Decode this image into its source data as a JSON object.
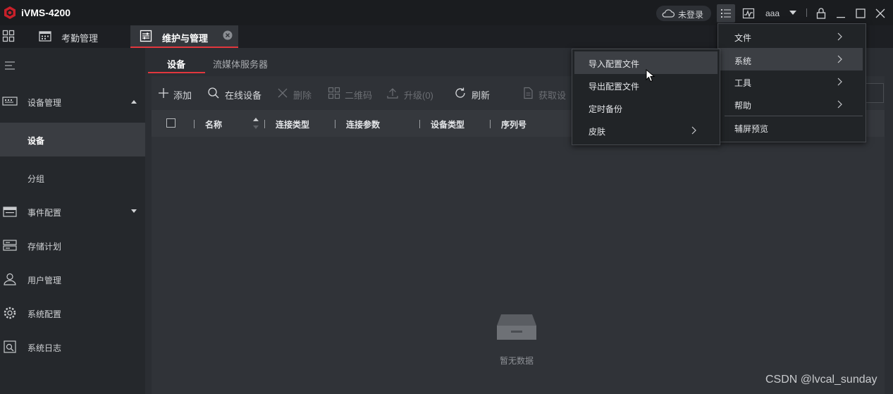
{
  "app": {
    "title": "iVMS-4200"
  },
  "titlebar": {
    "login_status": "未登录",
    "user": "aaa"
  },
  "tabs": [
    {
      "label": "考勤管理"
    },
    {
      "label": "维护与管理",
      "active": true
    }
  ],
  "sidebar": {
    "items": [
      {
        "label": "设备管理",
        "icon": "device-manage-icon",
        "expanded": true
      },
      {
        "label": "设备",
        "active": true
      },
      {
        "label": "分组"
      },
      {
        "label": "事件配置",
        "icon": "event-config-icon"
      },
      {
        "label": "存储计划",
        "icon": "storage-icon"
      },
      {
        "label": "用户管理",
        "icon": "user-icon"
      },
      {
        "label": "系统配置",
        "icon": "gear-icon"
      },
      {
        "label": "系统日志",
        "icon": "log-icon"
      }
    ]
  },
  "sub_tabs": [
    {
      "label": "设备",
      "active": true
    },
    {
      "label": "流媒体服务器"
    }
  ],
  "toolbar": {
    "add": "添加",
    "online": "在线设备",
    "delete": "删除",
    "qrcode": "二维码",
    "upgrade": "升级(0)",
    "refresh": "刷新",
    "get_device": "获取设"
  },
  "table": {
    "columns": [
      "名称",
      "连接类型",
      "连接参数",
      "设备类型",
      "序列号"
    ],
    "empty_text": "暂无数据"
  },
  "main_menu": {
    "items": [
      {
        "label": "文件",
        "has_submenu": true
      },
      {
        "label": "系统",
        "has_submenu": true,
        "hover": true
      },
      {
        "label": "工具",
        "has_submenu": true
      },
      {
        "label": "帮助",
        "has_submenu": true
      },
      {
        "label": "辅屏预览",
        "has_submenu": false
      }
    ]
  },
  "system_submenu": {
    "items": [
      {
        "label": "导入配置文件",
        "hover": true
      },
      {
        "label": "导出配置文件"
      },
      {
        "label": "定时备份"
      },
      {
        "label": "皮肤",
        "has_submenu": true
      }
    ]
  },
  "watermark": "CSDN @lvcal_sunday",
  "colors": {
    "accent": "#e2373d",
    "titlebar_bg": "#1a1c1f",
    "sidebar_bg": "#25282c",
    "main_bg": "#2b2e33",
    "menu_bg": "#212427"
  }
}
